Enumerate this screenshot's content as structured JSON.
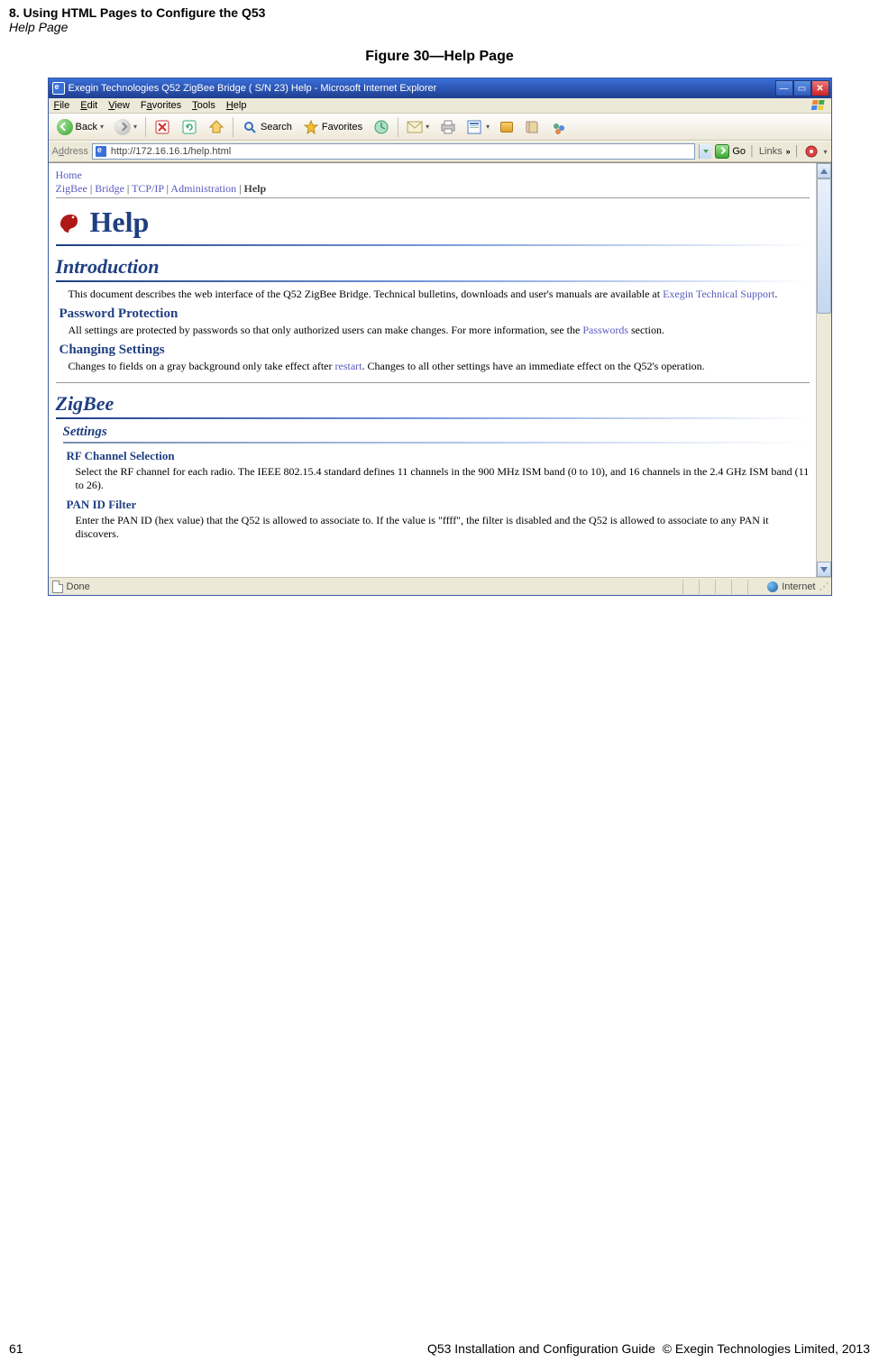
{
  "header": {
    "chapter": "8. Using HTML Pages to Configure the Q53",
    "section": "Help Page"
  },
  "figure_caption": "Figure 30—Help Page",
  "window": {
    "title": "Exegin Technologies Q52 ZigBee Bridge ( S/N 23) Help - Microsoft Internet Explorer",
    "menu": {
      "file": "File",
      "edit": "Edit",
      "view": "View",
      "favorites": "Favorites",
      "tools": "Tools",
      "help": "Help"
    },
    "toolbar": {
      "back": "Back",
      "search": "Search",
      "favorites": "Favorites"
    },
    "address_label": "Address",
    "url": "http://172.16.16.1/help.html",
    "go": "Go",
    "links": "Links",
    "status_done": "Done",
    "status_zone": "Internet"
  },
  "content": {
    "home": "Home",
    "crumbs": {
      "zigbee": "ZigBee",
      "bridge": "Bridge",
      "tcpip": "TCP/IP",
      "admin": "Administration",
      "help": "Help"
    },
    "help_title": "Help",
    "intro_h": "Introduction",
    "intro_p1a": "This document describes the web interface of the Q52 ZigBee Bridge. Technical bulletins, downloads and user's manuals are available at ",
    "intro_link": "Exegin Technical Support",
    "intro_p1b": ".",
    "pwd_h": "Password Protection",
    "pwd_p_a": "All settings are protected by passwords so that only authorized users can make changes. For more information, see the ",
    "pwd_link": "Passwords",
    "pwd_p_b": " section.",
    "chg_h": "Changing Settings",
    "chg_p_a": "Changes to fields on a gray background only take effect after ",
    "chg_link": "restart",
    "chg_p_b": ". Changes to all other settings have an immediate effect on the Q52's operation.",
    "zigbee_h": "ZigBee",
    "settings_h": "Settings",
    "rf_h": "RF Channel Selection",
    "rf_p": "Select the RF channel for each radio. The IEEE 802.15.4 standard defines 11 channels in the 900 MHz ISM band (0 to 10), and 16 channels in the 2.4 GHz ISM band (11 to 26).",
    "pan_h": "PAN ID Filter",
    "pan_p": "Enter the PAN ID (hex value) that the Q52 is allowed to associate to. If the value is \"ffff\", the filter is disabled and the Q52 is allowed to associate to any PAN it discovers."
  },
  "footer": {
    "page": "61",
    "center": "Q53 Installation and Configuration Guide",
    "right": "© Exegin Technologies Limited, 2013"
  }
}
